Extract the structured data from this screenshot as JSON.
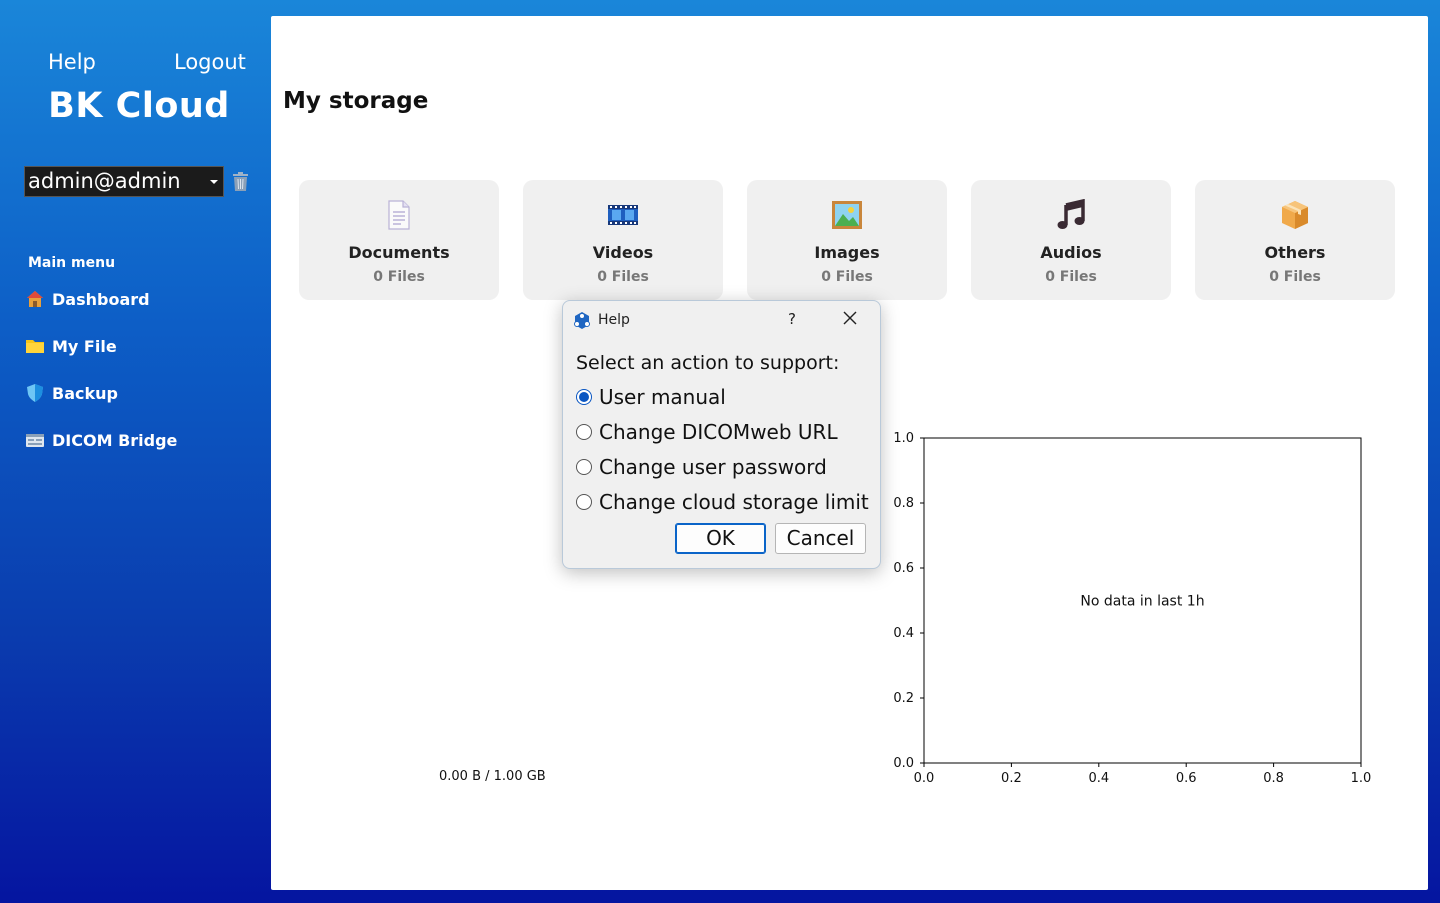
{
  "sidebar": {
    "help_label": "Help",
    "logout_label": "Logout",
    "app_title": "BK Cloud",
    "user_selected": "admin@admin",
    "menu_heading": "Main menu",
    "menu_items": [
      {
        "label": "Dashboard",
        "icon": "home-icon"
      },
      {
        "label": "My File",
        "icon": "folder-icon"
      },
      {
        "label": "Backup",
        "icon": "shield-icon"
      },
      {
        "label": "DICOM Bridge",
        "icon": "bridge-icon"
      }
    ]
  },
  "main": {
    "page_title": "My storage",
    "cards": [
      {
        "name": "Documents",
        "count": "0 Files",
        "icon": "document-icon"
      },
      {
        "name": "Videos",
        "count": "0 Files",
        "icon": "film-icon"
      },
      {
        "name": "Images",
        "count": "0 Files",
        "icon": "image-icon"
      },
      {
        "name": "Audios",
        "count": "0 Files",
        "icon": "music-icon"
      },
      {
        "name": "Others",
        "count": "0 Files",
        "icon": "package-icon"
      }
    ],
    "storage_usage": "0.00 B / 1.00 GB"
  },
  "dialog": {
    "title": "Help",
    "help_button": "?",
    "prompt": "Select an action to support:",
    "options": [
      {
        "label": "User manual",
        "selected": true
      },
      {
        "label": "Change DICOMweb URL",
        "selected": false
      },
      {
        "label": "Change user password",
        "selected": false
      },
      {
        "label": "Change cloud storage limit",
        "selected": false
      }
    ],
    "ok_label": "OK",
    "cancel_label": "Cancel"
  },
  "chart_data": {
    "type": "line",
    "series": [],
    "annotation": "No data in last 1h",
    "xlim": [
      0.0,
      1.0
    ],
    "ylim": [
      0.0,
      1.0
    ],
    "xticks": [
      "0.0",
      "0.2",
      "0.4",
      "0.6",
      "0.8",
      "1.0"
    ],
    "yticks": [
      "0.0",
      "0.2",
      "0.4",
      "0.6",
      "0.8",
      "1.0"
    ],
    "grid": false
  }
}
